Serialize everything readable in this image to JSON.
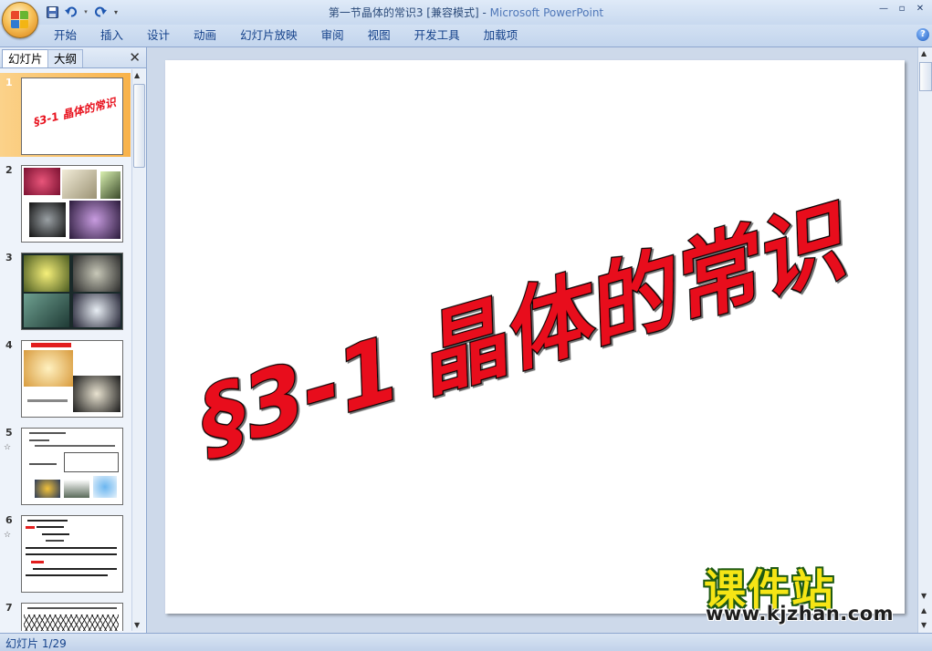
{
  "titlebar": {
    "doc_title": "第一节晶体的常识3 [兼容模式] -",
    "app_name": "Microsoft PowerPoint",
    "qat": {
      "save_icon": "save-icon",
      "undo_icon": "undo-icon",
      "redo_icon": "redo-icon",
      "customize_icon": "customize-qat-icon"
    },
    "window_buttons": {
      "minimize": "—",
      "restore": "▫",
      "close": "✕"
    }
  },
  "ribbon": {
    "tabs": [
      "开始",
      "插入",
      "设计",
      "动画",
      "幻灯片放映",
      "审阅",
      "视图",
      "开发工具",
      "加载项"
    ],
    "help": "?"
  },
  "left_pane": {
    "tabs": {
      "slides": "幻灯片",
      "outline": "大纲"
    },
    "close": "✕",
    "slides": [
      {
        "num": "1",
        "selected": true,
        "thumb_text": "§3-1 晶体的常识"
      },
      {
        "num": "2"
      },
      {
        "num": "3"
      },
      {
        "num": "4"
      },
      {
        "num": "5",
        "anim": "☆"
      },
      {
        "num": "6",
        "anim": "☆"
      },
      {
        "num": "7"
      }
    ]
  },
  "slide": {
    "title": "§3-1 晶体的常识",
    "title_color": "#e8111d"
  },
  "watermark": {
    "cn": "课件站",
    "url": "www.kjzhan.com"
  },
  "status": {
    "text": "幻灯片 1/29"
  }
}
